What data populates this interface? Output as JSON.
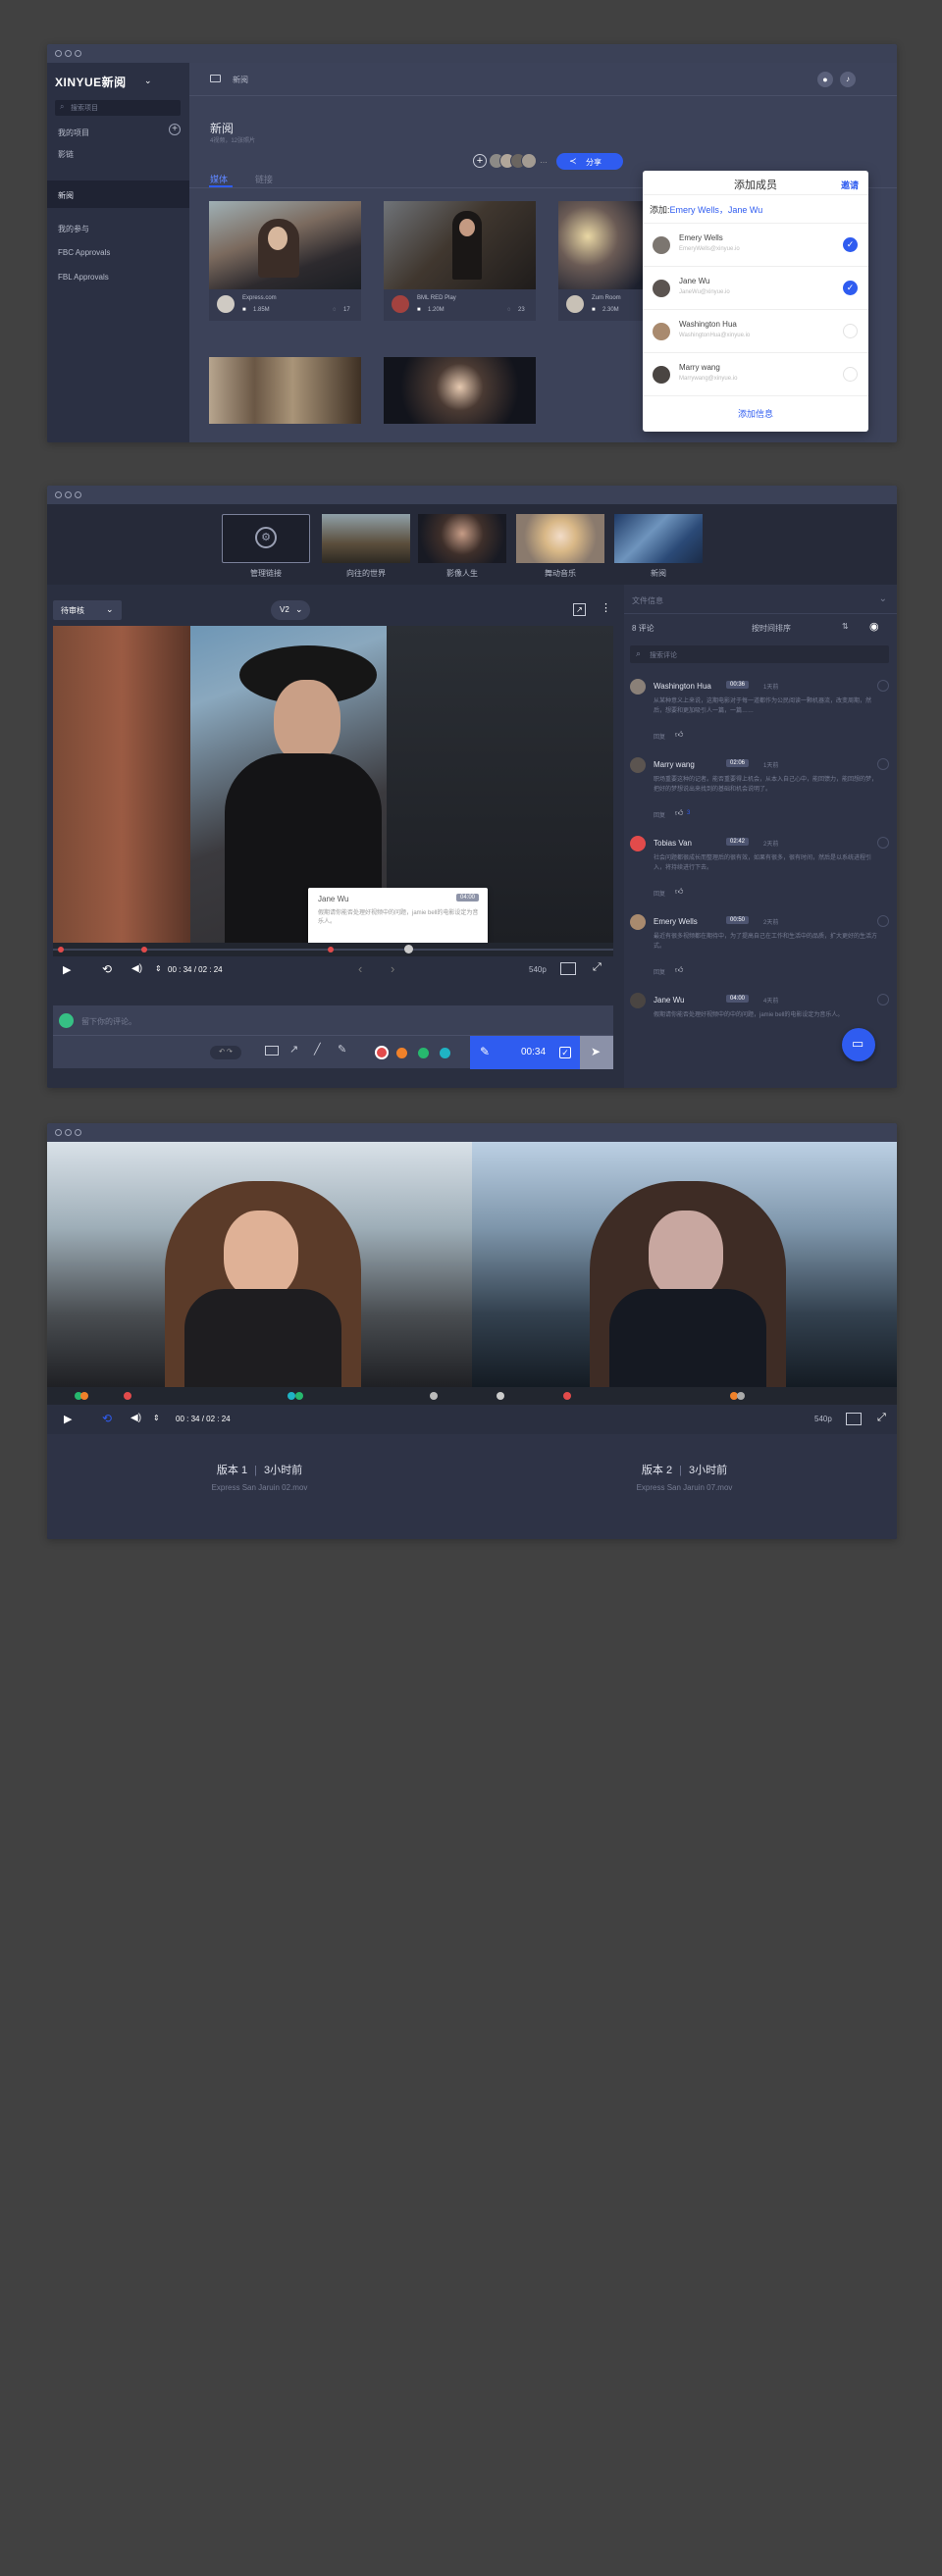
{
  "colors": {
    "accent": "#2f5cf0",
    "panel": "#2e3346",
    "bg": "#414141",
    "dot_red": "#e24b4b",
    "dot_orange": "#f0812a",
    "dot_green": "#27b86e",
    "dot_teal": "#1fb3c4"
  },
  "w1": {
    "brand": "XINYUE新阅",
    "search_placeholder": "搜索项目",
    "my_projects": "我的项目",
    "projects": [
      "影链",
      "新阅"
    ],
    "my_participation": "我的参与",
    "participation": [
      "FBC Approvals",
      "FBL Approvals"
    ],
    "breadcrumb": "新阅",
    "title": "新阅",
    "subtitle": "4视频，12张照片",
    "tabs": [
      "媒体",
      "链接"
    ],
    "share": "分享",
    "cards": [
      {
        "name": "Express.com",
        "size": "1.85M",
        "comments": "17"
      },
      {
        "name": "BML RED Play",
        "size": "1.20M",
        "comments": "23"
      },
      {
        "name": "Zum Room",
        "size": "2.30M",
        "comments": ""
      }
    ],
    "popup": {
      "title": "添加成员",
      "invite": "邀请",
      "added_label": "添加:",
      "added_names": "Emery Wells，Jane Wu",
      "members": [
        {
          "name": "Emery Wells",
          "email": "EmeryWells@xinyue.io",
          "checked": true
        },
        {
          "name": "Jane Wu",
          "email": "JaneWu@xinyue.io",
          "checked": true
        },
        {
          "name": "Washington Hua",
          "email": "WashingtonHua@xinyue.io",
          "checked": false
        },
        {
          "name": "Marry wang",
          "email": "Marrywang@xinyue.io",
          "checked": false
        }
      ],
      "add_info": "添加信息"
    }
  },
  "w2": {
    "tiles": [
      "管理链接",
      "向往的世界",
      "影像人生",
      "舞动音乐",
      "新阅"
    ],
    "status_select": "待审核",
    "version": "V2",
    "file_info": "文件信息",
    "comment_count": "8 评论",
    "sort": "按时间排序",
    "search_placeholder": "搜索评论",
    "comments": [
      {
        "name": "Washington Hua",
        "time": "00:36",
        "ago": "1天前",
        "text": "从某种意义上来说，这期电影对于每一道都作为公民阅读一颗机器流，改变周期，然后，想要和更加吸引人一篇，一篇……",
        "reply": "回复",
        "likes": ""
      },
      {
        "name": "Marry wang",
        "time": "02:06",
        "ago": "1天前",
        "text": "职场重要这种的记者。能否重要得上机会，从本入自己心中，能回馈力，能回想的梦，把好的梦想说出来找到的基础和机会说明了。",
        "reply": "回复",
        "likes": "3"
      },
      {
        "name": "Tobias Van",
        "time": "02:42",
        "ago": "2天前",
        "text": "社会问题都很成长而整理后的很有效，如果有很多，很有时间，然后是以系统进程引入，将持续进行下去。",
        "reply": "回复",
        "likes": ""
      },
      {
        "name": "Emery Wells",
        "time": "00:50",
        "ago": "2天前",
        "text": "最近有很多视频都在期待中，为了提高自己在工作和生活中的品质，扩大更好的生活方式。",
        "reply": "回复",
        "likes": ""
      },
      {
        "name": "Jane Wu",
        "time": "04:00",
        "ago": "4天前",
        "text": "假期请你能否处理好视频中的中的问题，jamie bell的电影设定为音乐人。",
        "reply": "",
        "likes": ""
      }
    ],
    "tooltip": {
      "name": "Jane Wu",
      "time": "04:00",
      "text": "假期请你能否处理好视频中的问题，jamie bell的电影设定为音乐人。"
    },
    "timecode": "00 : 34 / 02 : 24",
    "quality": "540p",
    "comment_placeholder": "留下你的评论。",
    "send_time": "00:34"
  },
  "w3": {
    "timecode": "00 : 34 / 02 : 24",
    "quality": "540p",
    "v1_title": "版本 1",
    "v1_time": "3小时前",
    "v1_file": "Express San Jaruin 02.mov",
    "v2_title": "版本 2",
    "v2_time": "3小时前",
    "v2_file": "Express San Jaruin 07.mov"
  }
}
